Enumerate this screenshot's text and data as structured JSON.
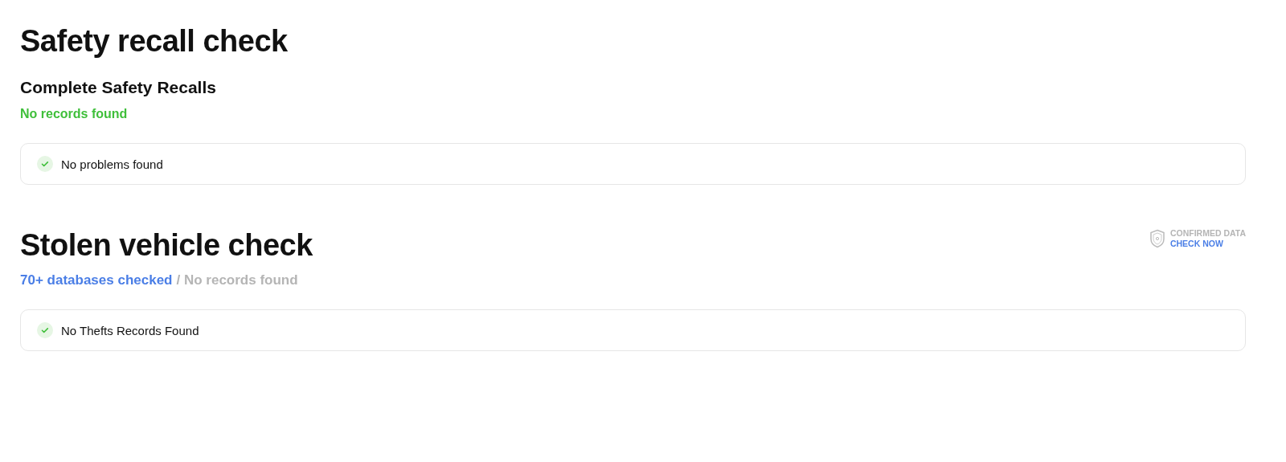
{
  "sections": [
    {
      "title": "Safety recall check",
      "subtitle": "Complete Safety Recalls",
      "status": "No records found",
      "items": [
        {
          "text": "No problems found"
        }
      ]
    },
    {
      "title": "Stolen vehicle check",
      "badge": {
        "label": "CONFIRMED DATA",
        "link": "CHECK NOW"
      },
      "sources": "70+ databases checked",
      "status_separated": "/ No records found",
      "items": [
        {
          "text": "No Thefts Records Found"
        }
      ]
    }
  ]
}
